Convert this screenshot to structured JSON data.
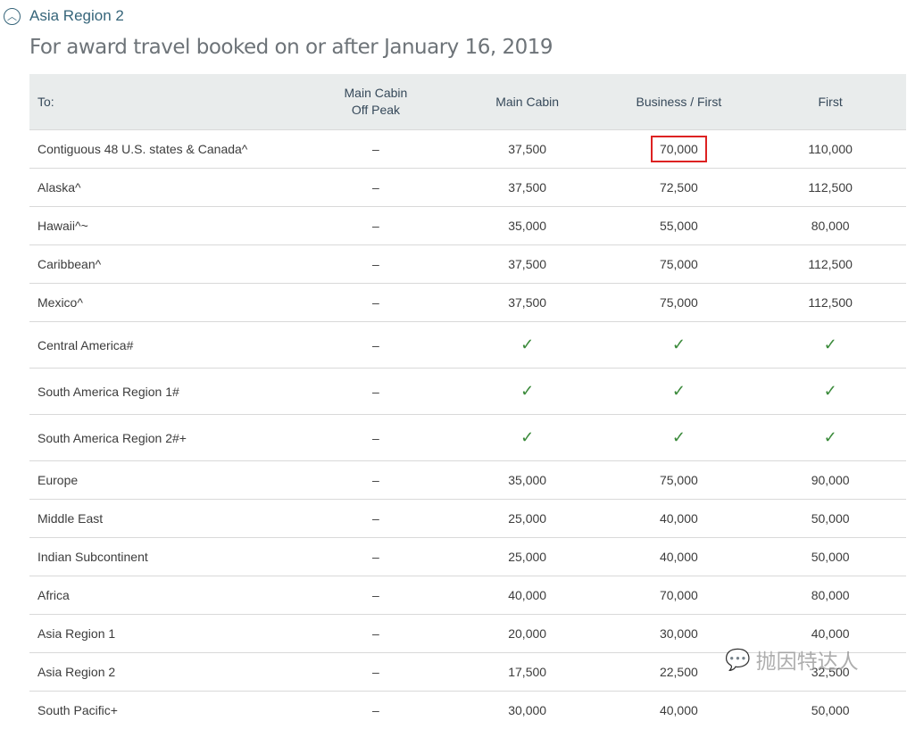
{
  "accordion": {
    "label": "Asia Region 2",
    "icon": "chevron-up-circle-icon"
  },
  "title": "For award travel booked on or after January 16, 2019",
  "columns": [
    "To:",
    "Main Cabin\nOff Peak",
    "Main Cabin",
    "Business / First",
    "First"
  ],
  "rows": [
    {
      "to": "Contiguous 48 U.S. states & Canada^",
      "off": "–",
      "main": "37,500",
      "biz": "70,000",
      "first": "110,000",
      "highlight": "biz"
    },
    {
      "to": "Alaska^",
      "off": "–",
      "main": "37,500",
      "biz": "72,500",
      "first": "112,500"
    },
    {
      "to": "Hawaii^~",
      "off": "–",
      "main": "35,000",
      "biz": "55,000",
      "first": "80,000"
    },
    {
      "to": "Caribbean^",
      "off": "–",
      "main": "37,500",
      "biz": "75,000",
      "first": "112,500"
    },
    {
      "to": "Mexico^",
      "off": "–",
      "main": "37,500",
      "biz": "75,000",
      "first": "112,500"
    },
    {
      "to": "Central America#",
      "off": "–",
      "main": "✓",
      "biz": "✓",
      "first": "✓"
    },
    {
      "to": "South America Region 1#",
      "off": "–",
      "main": "✓",
      "biz": "✓",
      "first": "✓"
    },
    {
      "to": "South America Region 2#+",
      "off": "–",
      "main": "✓",
      "biz": "✓",
      "first": "✓"
    },
    {
      "to": "Europe",
      "off": "–",
      "main": "35,000",
      "biz": "75,000",
      "first": "90,000"
    },
    {
      "to": "Middle East",
      "off": "–",
      "main": "25,000",
      "biz": "40,000",
      "first": "50,000"
    },
    {
      "to": "Indian Subcontinent",
      "off": "–",
      "main": "25,000",
      "biz": "40,000",
      "first": "50,000"
    },
    {
      "to": "Africa",
      "off": "–",
      "main": "40,000",
      "biz": "70,000",
      "first": "80,000"
    },
    {
      "to": "Asia Region 1",
      "off": "–",
      "main": "20,000",
      "biz": "30,000",
      "first": "40,000"
    },
    {
      "to": "Asia Region 2",
      "off": "–",
      "main": "17,500",
      "biz": "22,500",
      "first": "32,500"
    },
    {
      "to": "South Pacific+",
      "off": "–",
      "main": "30,000",
      "biz": "40,000",
      "first": "50,000"
    }
  ],
  "watermark": "抛因特达人",
  "colors": {
    "accent": "#36657a",
    "highlight": "#dd2222",
    "check": "#3a8a3a"
  }
}
